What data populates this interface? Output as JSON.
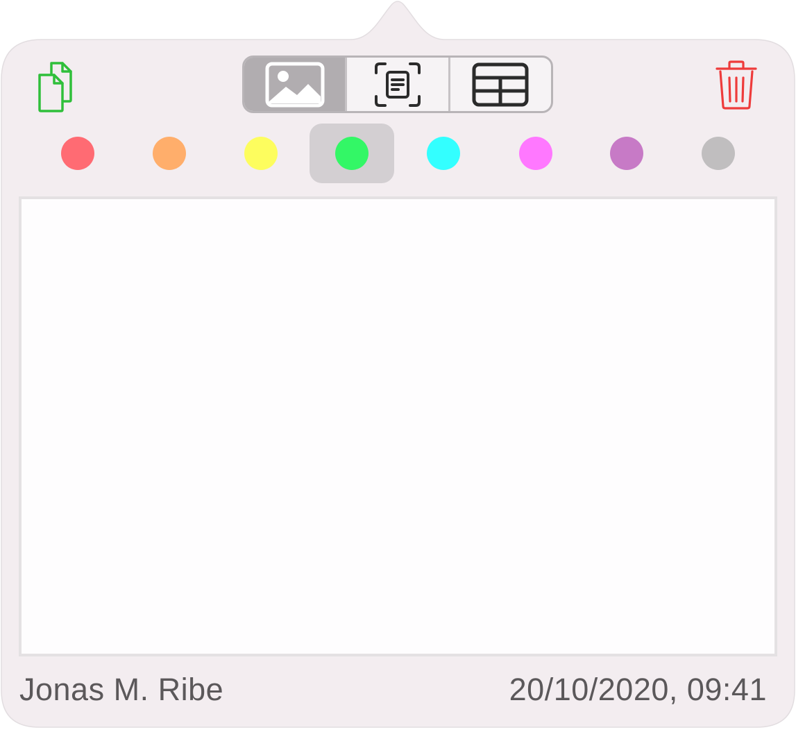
{
  "modes": {
    "items": [
      {
        "icon": "photo-icon",
        "active": true
      },
      {
        "icon": "text-scan-icon",
        "active": false
      },
      {
        "icon": "table-icon",
        "active": false
      }
    ]
  },
  "toolbar": {
    "copy_icon": "copy-documents-icon",
    "delete_icon": "trash-icon",
    "copy_color": "#2fbf3a",
    "delete_color": "#ee3b3b"
  },
  "colors": {
    "selected_index": 3,
    "swatches": [
      "#ff6b73",
      "#ffae6b",
      "#fdfd5e",
      "#33f766",
      "#33ffff",
      "#ff78ff",
      "#c77ac6",
      "#c0bebf"
    ]
  },
  "note": {
    "text": ""
  },
  "footer": {
    "author": "Jonas M. Ribe",
    "timestamp": "20/10/2020, 09:41"
  },
  "theme": {
    "popover_bg": "#f3edf0"
  }
}
